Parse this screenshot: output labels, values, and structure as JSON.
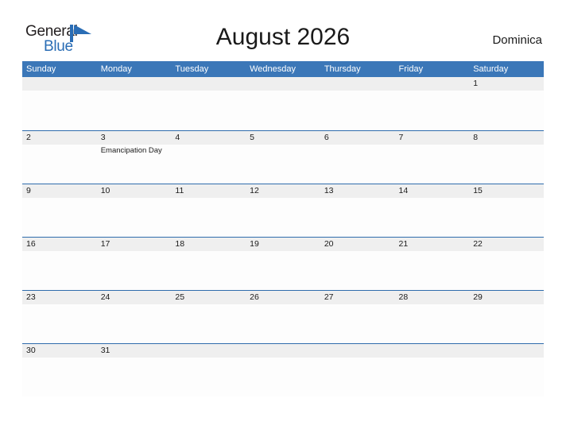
{
  "header": {
    "logo": {
      "word_one": "General",
      "word_two": "Blue",
      "mark_name": "blue-triangle-flag-icon",
      "dark_color": "#231f20",
      "blue_color": "#2a6db5"
    },
    "title": "August 2026",
    "country": "Dominica"
  },
  "theme": {
    "header_blue": "#3b77b8",
    "row_divider_blue": "#2f6cac",
    "band_gray": "#efefef",
    "cell_white": "#fdfdfd",
    "text_dark": "#1a1a1a"
  },
  "calendar": {
    "weekdays": [
      "Sunday",
      "Monday",
      "Tuesday",
      "Wednesday",
      "Thursday",
      "Friday",
      "Saturday"
    ],
    "weeks": [
      [
        {
          "day": ""
        },
        {
          "day": ""
        },
        {
          "day": ""
        },
        {
          "day": ""
        },
        {
          "day": ""
        },
        {
          "day": ""
        },
        {
          "day": "1"
        }
      ],
      [
        {
          "day": "2"
        },
        {
          "day": "3",
          "event": "Emancipation Day"
        },
        {
          "day": "4"
        },
        {
          "day": "5"
        },
        {
          "day": "6"
        },
        {
          "day": "7"
        },
        {
          "day": "8"
        }
      ],
      [
        {
          "day": "9"
        },
        {
          "day": "10"
        },
        {
          "day": "11"
        },
        {
          "day": "12"
        },
        {
          "day": "13"
        },
        {
          "day": "14"
        },
        {
          "day": "15"
        }
      ],
      [
        {
          "day": "16"
        },
        {
          "day": "17"
        },
        {
          "day": "18"
        },
        {
          "day": "19"
        },
        {
          "day": "20"
        },
        {
          "day": "21"
        },
        {
          "day": "22"
        }
      ],
      [
        {
          "day": "23"
        },
        {
          "day": "24"
        },
        {
          "day": "25"
        },
        {
          "day": "26"
        },
        {
          "day": "27"
        },
        {
          "day": "28"
        },
        {
          "day": "29"
        }
      ],
      [
        {
          "day": "30"
        },
        {
          "day": "31"
        },
        {
          "day": ""
        },
        {
          "day": ""
        },
        {
          "day": ""
        },
        {
          "day": ""
        },
        {
          "day": ""
        }
      ]
    ]
  }
}
